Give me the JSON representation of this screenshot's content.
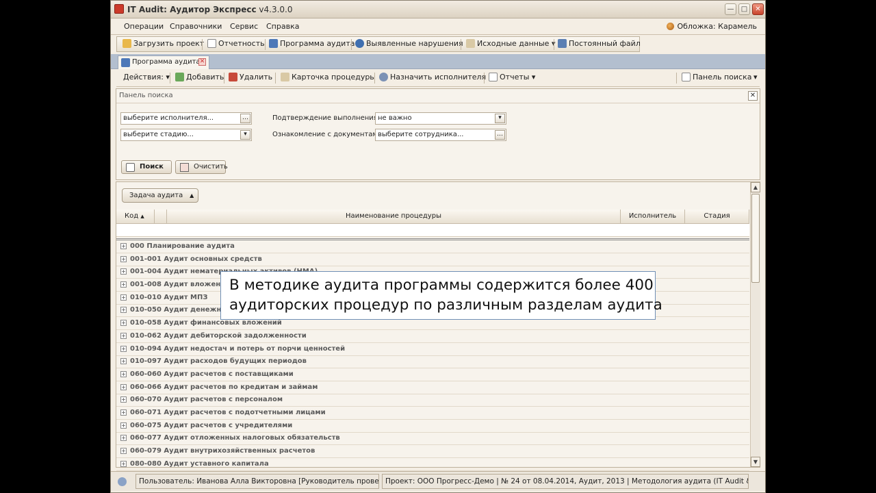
{
  "window": {
    "title_app": "IT Audit: Аудитор Экспресс",
    "title_version": "v4.3.0.0"
  },
  "menu": {
    "items": [
      "Операции",
      "Справочники",
      "Сервис",
      "Справка"
    ],
    "skin_label": "Обложка: Карамель"
  },
  "main_toolbar": {
    "load_project": "Загрузить проект",
    "reports": "Отчетность",
    "audit_program": "Программа аудита",
    "violations": "Выявленные нарушения",
    "source_data": "Исходные данные",
    "permanent_file": "Постоянный файл"
  },
  "tab": {
    "label": "Программа аудита"
  },
  "grid_toolbar": {
    "actions": "Действия:",
    "add": "Добавить",
    "delete": "Удалить",
    "procedure_card": "Карточка процедуры",
    "assign_executor": "Назначить исполнителя",
    "reports": "Отчеты",
    "search_panel": "Панель поиска"
  },
  "search_panel": {
    "title": "Панель поиска",
    "executor_value": "выберите исполнителя...",
    "stage_value": "выберите стадию...",
    "confirm_label": "Подтверждение выполнения:",
    "confirm_value": "не важно",
    "docs_label": "Ознакомление с документами:",
    "docs_value": "выберите сотрудника...",
    "search_button": "Поиск",
    "clear_button": "Очистить"
  },
  "grid": {
    "group_by": "Задача аудита",
    "columns": [
      "Код",
      "Наименование процедуры",
      "Исполнитель",
      "Стадия"
    ],
    "rows": [
      "000 Планирование аудита",
      "001-001 Аудит основных средств",
      "001-004 Аудит нематериальных активов (НМА)",
      "001-008 Аудит вложений во внеоборотные активы",
      "010-010 Аудит МПЗ",
      "010-050 Аудит денежных средств",
      "010-058 Аудит финансовых вложений",
      "010-062 Аудит дебиторской задолженности",
      "010-094 Аудит недостач и потерь от порчи ценностей",
      "010-097 Аудит расходов будущих периодов",
      "060-060 Аудит расчетов с поставщиками",
      "060-066 Аудит расчетов по кредитам и займам",
      "060-070 Аудит расчетов с персоналом",
      "060-071 Аудит расчетов с подотчетными лицами",
      "060-075 Аудит расчетов с учредителями",
      "060-077 Аудит отложенных налоговых обязательств",
      "060-079 Аудит внутрихозяйственных расчетов",
      "080-080 Аудит уставного капитала"
    ]
  },
  "statusbar": {
    "user": "Пользователь: Иванова Алла Викторовна [Руководитель проверки]",
    "project": "Проект: ООО Прогресс-Демо | № 24 от 08.04.2014, Аудит, 2013 | Методология аудита (IT Audit & Pravo)"
  },
  "callout": {
    "line1": "В методике аудита программы содержится более 400",
    "line2": "аудиторских процедур по различным разделам аудита"
  },
  "colors": {
    "window_bg": "#f4eee4",
    "tab_strip": "#b3bfcf",
    "callout_border": "#6f8fb5"
  }
}
